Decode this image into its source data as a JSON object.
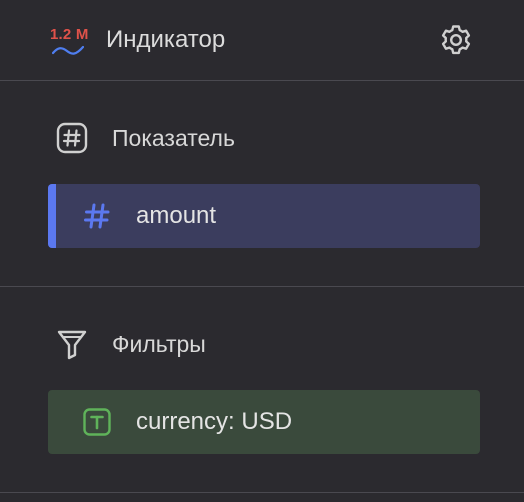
{
  "header": {
    "logo_text": "1.2 M",
    "title": "Индикатор",
    "settings_icon": "gear-icon"
  },
  "sections": {
    "measure": {
      "icon": "hash-square-icon",
      "title": "Показатель",
      "field": {
        "icon": "hash-icon",
        "label": "amount"
      }
    },
    "filters": {
      "icon": "funnel-icon",
      "title": "Фильтры",
      "field": {
        "icon": "text-type-icon",
        "label": "currency: USD"
      }
    }
  },
  "colors": {
    "background": "#2b2a2f",
    "measure_chip": "#3b3d5e",
    "measure_accent": "#5b78f0",
    "filter_chip": "#3a4a3c",
    "filter_icon": "#5fb35a",
    "logo_red": "#e0524a",
    "logo_blue": "#4f7ef0"
  }
}
